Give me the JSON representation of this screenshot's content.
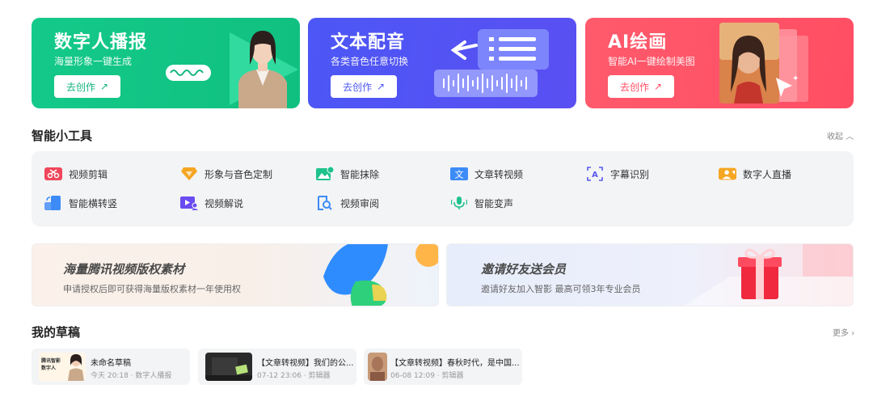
{
  "heroes": [
    {
      "title": "数字人播报",
      "subtitle": "海量形象一键生成",
      "button": "去创作"
    },
    {
      "title": "文本配音",
      "subtitle": "各类音色任意切换",
      "button": "去创作"
    },
    {
      "title": "AI绘画",
      "subtitle": "智能AI一键绘制美图",
      "button": "去创作"
    }
  ],
  "tools_section": {
    "title": "智能小工具",
    "collapse": "收起"
  },
  "tools": [
    {
      "label": "视频剪辑",
      "icon": "scissors-icon"
    },
    {
      "label": "形象与音色定制",
      "icon": "diamond-icon"
    },
    {
      "label": "智能抹除",
      "icon": "image-erase-icon"
    },
    {
      "label": "文章转视频",
      "icon": "text-document-icon"
    },
    {
      "label": "字幕识别",
      "icon": "subtitle-scan-icon"
    },
    {
      "label": "数字人直播",
      "icon": "live-avatar-icon"
    },
    {
      "label": "智能横转竖",
      "icon": "rotate-screen-icon"
    },
    {
      "label": "视频解说",
      "icon": "video-narration-icon"
    },
    {
      "label": "视频审阅",
      "icon": "search-review-icon"
    },
    {
      "label": "智能变声",
      "icon": "microphone-icon"
    }
  ],
  "banners": [
    {
      "title": "海量腾讯视频版权素材",
      "subtitle": "申请授权后即可获得海量版权素材一年使用权"
    },
    {
      "title": "邀请好友送会员",
      "subtitle": "邀请好友加入智影 最高可领3年专业会员"
    }
  ],
  "drafts_section": {
    "title": "我的草稿",
    "more": "更多"
  },
  "drafts": [
    {
      "title": "未命名草稿",
      "meta": "今天 20:18 · 数字人播报",
      "thumb_text": "腾讯智影数字人"
    },
    {
      "title": "【文章转视频】我们的公...",
      "meta": "07-12 23:06 · 剪辑器"
    },
    {
      "title": "【文章转视频】春秋时代，是中国...",
      "meta": "06-08 12:09 · 剪辑器"
    }
  ]
}
